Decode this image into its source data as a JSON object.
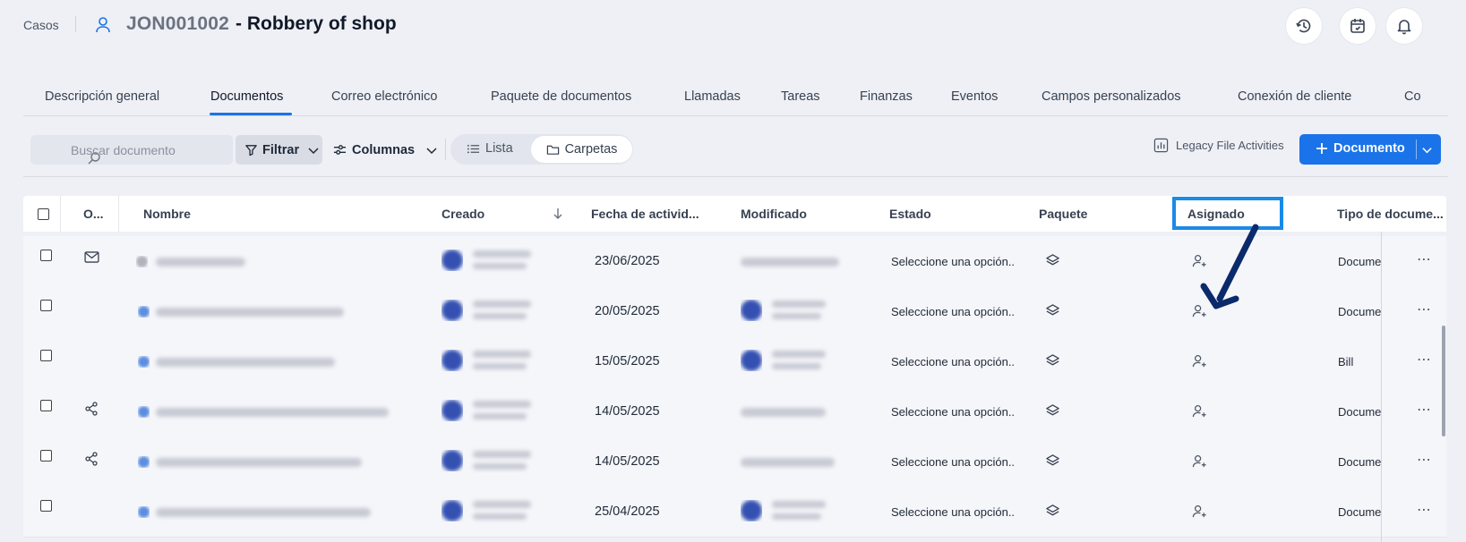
{
  "header": {
    "breadcrumb": "Casos",
    "case_id": "JON001002",
    "case_title": "- Robbery of shop",
    "icons": [
      "history-icon",
      "calendar-icon",
      "bell-icon"
    ]
  },
  "tabs": [
    {
      "label": "Descripción general",
      "active": false
    },
    {
      "label": "Documentos",
      "active": true
    },
    {
      "label": "Correo electrónico",
      "active": false
    },
    {
      "label": "Paquete de documentos",
      "active": false
    },
    {
      "label": "Llamadas",
      "active": false
    },
    {
      "label": "Tareas",
      "active": false
    },
    {
      "label": "Finanzas",
      "active": false
    },
    {
      "label": "Eventos",
      "active": false
    },
    {
      "label": "Campos personalizados",
      "active": false
    },
    {
      "label": "Conexión de cliente",
      "active": false
    },
    {
      "label": "Co",
      "active": false
    }
  ],
  "toolbar": {
    "search_placeholder": "Buscar documento",
    "filter_label": "Filtrar",
    "columns_label": "Columnas",
    "view_list_label": "Lista",
    "view_folders_label": "Carpetas",
    "legacy_label": "Legacy File Activities",
    "add_document_label": "Documento"
  },
  "table": {
    "columns": [
      "O...",
      "Nombre",
      "Creado",
      "Fecha de activid...",
      "Modificado",
      "Estado",
      "Paquete",
      "Asignado",
      "Tipo de docume..."
    ],
    "rows": [
      {
        "origin_icon": "mail-icon",
        "fecha": "23/06/2025",
        "estado": "Seleccione una opción..",
        "tipo": "Docume",
        "modified_avatar": false
      },
      {
        "origin_icon": "",
        "fecha": "20/05/2025",
        "estado": "Seleccione una opción..",
        "tipo": "Docume",
        "modified_avatar": true
      },
      {
        "origin_icon": "",
        "fecha": "15/05/2025",
        "estado": "Seleccione una opción..",
        "tipo": "Bill",
        "modified_avatar": true
      },
      {
        "origin_icon": "share-icon",
        "fecha": "14/05/2025",
        "estado": "Seleccione una opción..",
        "tipo": "Docume",
        "modified_avatar": false
      },
      {
        "origin_icon": "share-icon",
        "fecha": "14/05/2025",
        "estado": "Seleccione una opción..",
        "tipo": "Docume",
        "modified_avatar": false
      },
      {
        "origin_icon": "",
        "fecha": "25/04/2025",
        "estado": "Seleccione una opción..",
        "tipo": "Docume",
        "modified_avatar": true
      }
    ]
  },
  "colors": {
    "accent": "#1a73e8",
    "highlight_box": "#1a8ae8",
    "arrow": "#0b2a6b"
  }
}
